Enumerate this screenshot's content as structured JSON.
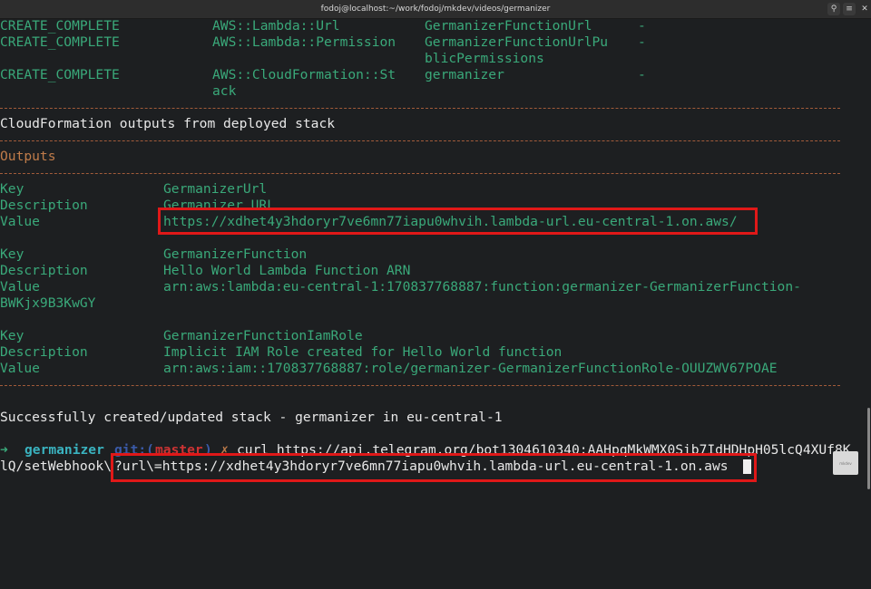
{
  "window": {
    "title": "fodoj@localhost:~/work/fodoj/mkdev/videos/germanizer",
    "search_icon": "search-icon",
    "menu_icon": "hamburger-icon",
    "close_icon": "close-icon"
  },
  "resources": [
    {
      "status": "CREATE_COMPLETE",
      "type": "AWS::Lambda::Url",
      "logical": "GermanizerFunctionUrl",
      "logical_cont": "",
      "reason": "-"
    },
    {
      "status": "CREATE_COMPLETE",
      "type": "AWS::Lambda::Permission",
      "logical": "GermanizerFunctionUrlPu",
      "logical_cont": "blicPermissions",
      "reason": "-"
    },
    {
      "status": "CREATE_COMPLETE",
      "type": "AWS::CloudFormation::St",
      "type_cont": "ack",
      "logical": "germanizer",
      "reason": "-"
    }
  ],
  "outputs_heading": "CloudFormation outputs from deployed stack",
  "outputs_label": "Outputs",
  "outputs": [
    {
      "key_label": "Key",
      "desc_label": "Description",
      "value_label": "Value",
      "key": "GermanizerUrl",
      "description": "Germanizer URL",
      "value": "https://xdhet4y3hdoryr7ve6mn77iapu0whvih.lambda-url.eu-central-1.on.aws/"
    },
    {
      "key_label": "Key",
      "desc_label": "Description",
      "value_label": "Value",
      "key": "GermanizerFunction",
      "description": "Hello World Lambda Function ARN",
      "value": "arn:aws:lambda:eu-central-1:170837768887:function:germanizer-GermanizerFunction-",
      "value_cont": "BWKjx9B3KwGY"
    },
    {
      "key_label": "Key",
      "desc_label": "Description",
      "value_label": "Value",
      "key": "GermanizerFunctionIamRole",
      "description": "Implicit IAM Role created for Hello World function",
      "value": "arn:aws:iam::170837768887:role/germanizer-GermanizerFunctionRole-OUUZWV67POAE"
    }
  ],
  "success_message": "Successfully created/updated stack - germanizer in eu-central-1",
  "prompt": {
    "arrow": "➜",
    "dir": "germanizer",
    "git_label": "git:(",
    "branch": "master",
    "git_close": ")",
    "dirty": "✗",
    "command": "curl https://api.telegram.org/bot1304610340:AAHpqMkWMX0Sib7IdHDHpH05lcQ4XUf8K",
    "command_cont1": "lQ/setWebhook\\",
    "command_cont2": "?url\\=https://xdhet4y3hdoryr7ve6mn77iapu0whvih.lambda-url.eu-central-1.on.aws"
  },
  "badge_text": "mkdev"
}
